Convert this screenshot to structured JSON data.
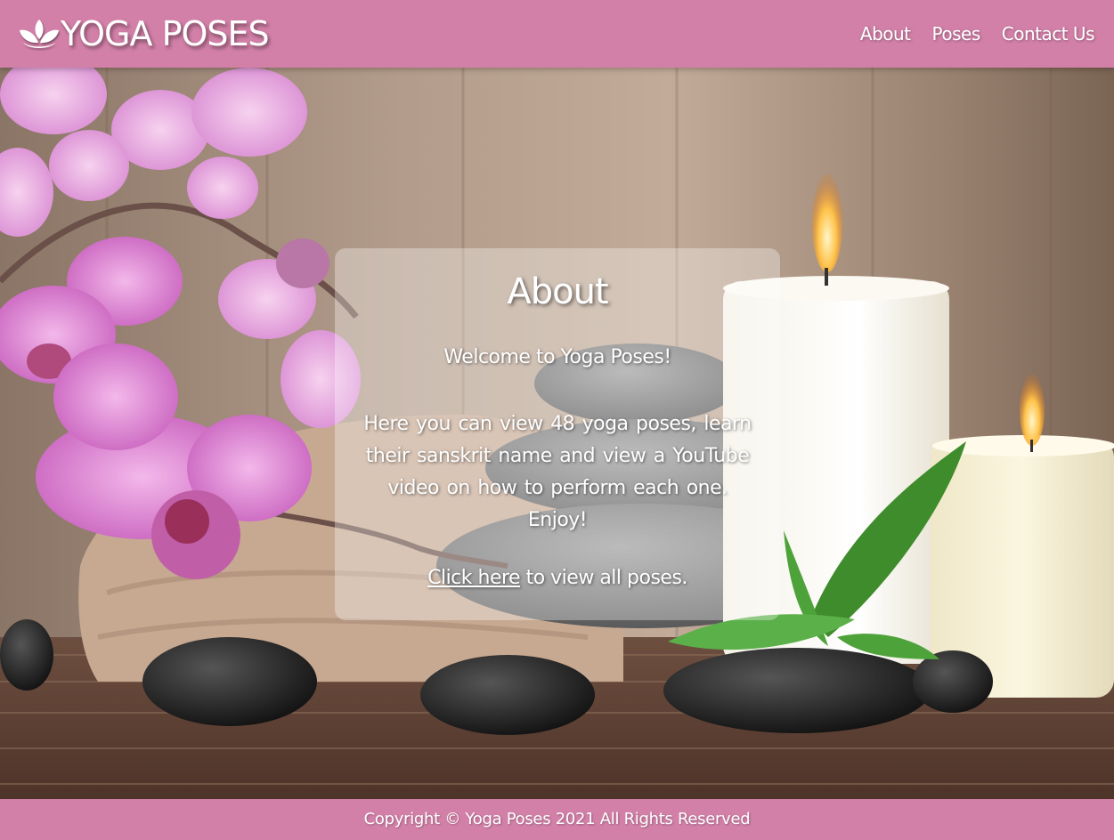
{
  "header": {
    "brand_name": "YOGA POSES",
    "logo_icon": "lotus-icon",
    "nav": [
      {
        "label": "About"
      },
      {
        "label": "Poses"
      },
      {
        "label": "Contact Us"
      }
    ]
  },
  "about": {
    "title": "About",
    "welcome": "Welcome to Yoga Poses!",
    "description": "Here you can view 48 yoga poses, learn their sanskrit name and view a YouTube video on how to perform each one. Enjoy!",
    "cta_link": "Click here",
    "cta_rest": " to view all poses."
  },
  "footer": {
    "copyright": "Copyright © Yoga Poses 2021 All Rights Reserved"
  },
  "colors": {
    "accent": "#d380a8",
    "text": "#ffffff"
  }
}
